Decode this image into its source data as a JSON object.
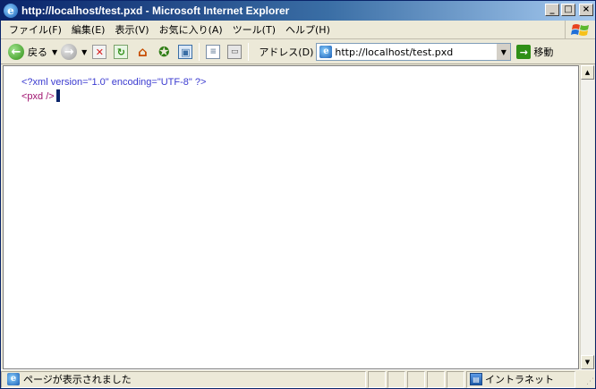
{
  "window": {
    "title": "http://localhost/test.pxd - Microsoft Internet Explorer",
    "controls": {
      "minimize": "_",
      "maximize": "□",
      "close": "×"
    }
  },
  "menu": {
    "items": [
      {
        "label": "ファイル(F)"
      },
      {
        "label": "編集(E)"
      },
      {
        "label": "表示(V)"
      },
      {
        "label": "お気に入り(A)"
      },
      {
        "label": "ツール(T)"
      },
      {
        "label": "ヘルプ(H)"
      }
    ]
  },
  "toolbar": {
    "back_label": "戻る",
    "icons": [
      "back-icon",
      "forward-icon",
      "stop-icon",
      "refresh-icon",
      "home-icon",
      "favorites-icon",
      "history-icon",
      "copy-page-icon",
      "print-icon"
    ]
  },
  "address": {
    "label": "アドレス(D)",
    "value": "http://localhost/test.pxd",
    "go_label": "移動"
  },
  "content": {
    "xml_declaration": "<?xml version=\"1.0\" encoding=\"UTF-8\" ?>",
    "root_element": "<pxd />"
  },
  "status": {
    "text": "ページが表示されました",
    "zone": "イントラネット"
  },
  "colors": {
    "title_gradient_start": "#0a246a",
    "title_gradient_end": "#a6caf0",
    "xml_declaration": "#3b3bd0",
    "xml_element": "#a0126f"
  }
}
